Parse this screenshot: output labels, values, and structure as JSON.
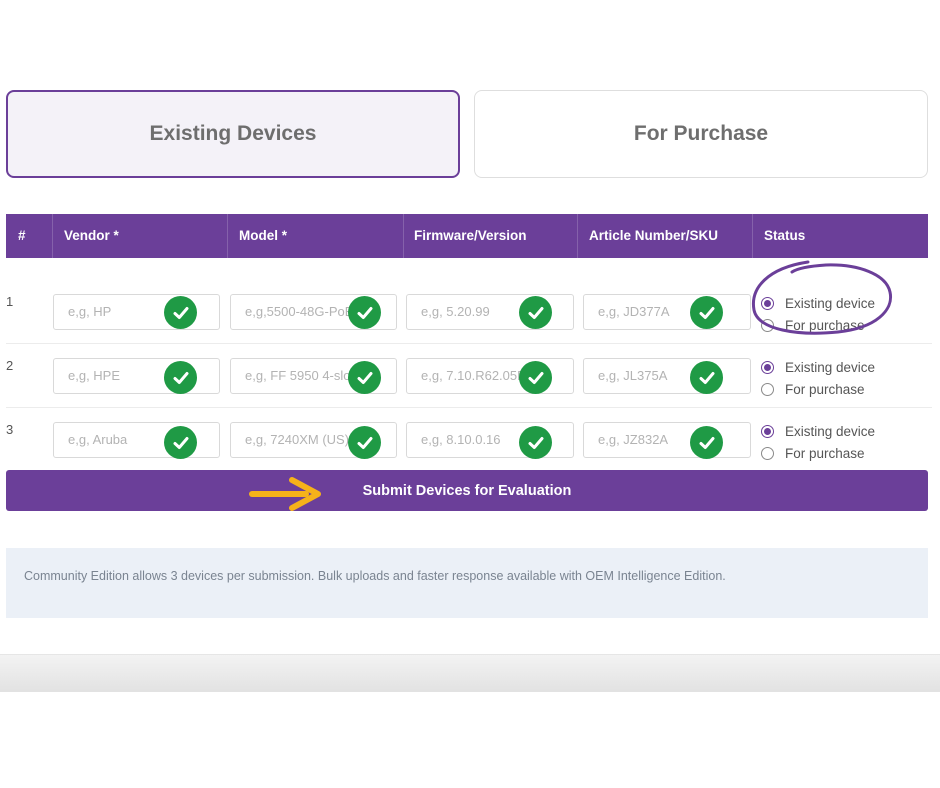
{
  "tabs": {
    "existing": "Existing Devices",
    "purchase": "For Purchase"
  },
  "table": {
    "headers": {
      "num": "#",
      "vendor": "Vendor *",
      "model": "Model *",
      "firmware": "Firmware/Version",
      "sku": "Article Number/SKU",
      "status": "Status"
    },
    "rows": [
      {
        "num": "1",
        "vendor": "e,g, HP",
        "model": "e,g,5500-48G-PoE+",
        "firmware": "e,g, 5.20.99",
        "sku": "e,g, JD377A",
        "status": "Existing device"
      },
      {
        "num": "2",
        "vendor": "e,g, HPE",
        "model": "e,g, FF 5950 4-slot",
        "firmware": "e,g, 7.10.R62.05P",
        "sku": "e,g, JL375A",
        "status": "Existing device"
      },
      {
        "num": "3",
        "vendor": "e,g, Aruba",
        "model": "e,g, 7240XM (US)",
        "firmware": "e,g, 8.10.0.16",
        "sku": "e,g, JZ832A",
        "status": "Existing device"
      }
    ],
    "status_options": [
      "Existing device",
      "For purchase"
    ]
  },
  "submit_label": "Submit Devices for Evaluation",
  "info_text": "Community Edition allows 3 devices per submission. Bulk uploads and faster response available with OEM Intelligence Edition.",
  "colors": {
    "accent": "#6b3f99",
    "check": "#1f9a45",
    "arrow": "#f6b21a"
  },
  "icons": {
    "check": "check-circle-icon",
    "arrow": "arrow-right-icon"
  }
}
